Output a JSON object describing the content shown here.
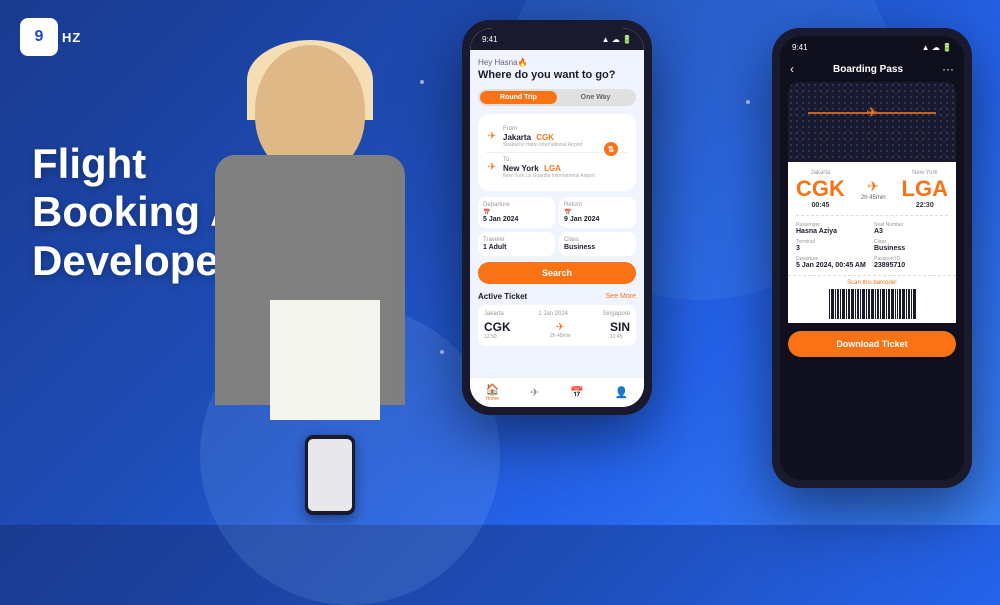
{
  "logo": {
    "icon": "9",
    "suffix": "HZ"
  },
  "headline": {
    "line1": "Flight",
    "line2": "Booking App",
    "line3": "Developers"
  },
  "phone1": {
    "status_time": "9:41",
    "greeting": "Hey Hasna🔥",
    "question": "Where do you want to go?",
    "trip_toggle": {
      "round_trip": "Round Trip",
      "one_way": "One Way"
    },
    "from_label": "From",
    "from_city": "Jakarta",
    "from_code": "CGK",
    "from_airport": "Soekarno Hatto International Airport",
    "to_label": "To",
    "to_city": "New York",
    "to_code": "LGA",
    "to_airport": "New York La Guardia International Airport",
    "departure_label": "Departure",
    "departure_date": "5 Jan 2024",
    "return_label": "Return",
    "return_date": "9 Jan 2024",
    "traveler_label": "Traveler",
    "traveler_value": "1 Adult",
    "class_label": "Class",
    "class_value": "Business",
    "search_btn": "Search",
    "active_ticket_label": "Active Ticket",
    "see_more": "See More",
    "ticket_from": "Jakarta",
    "ticket_date": "1 Jan 2024",
    "ticket_to": "Singapore",
    "ticket_from_code": "CGK",
    "ticket_to_code": "SIN",
    "ticket_from_time": "12:50",
    "ticket_duration": "2h 45min",
    "ticket_to_time": "12:45",
    "nav_home": "Home",
    "nav_flight": "✈",
    "nav_calendar": "📅",
    "nav_profile": "👤"
  },
  "phone2": {
    "status_time": "9:41",
    "title": "Boarding Pass",
    "from_city": "Jakarta",
    "from_code": "CGK",
    "from_time": "00:45",
    "duration": "2h 45min",
    "to_city": "New York",
    "to_code": "LGA",
    "to_time": "22:30",
    "passenger_label": "Passenger",
    "passenger_value": "Hasna Aziya",
    "seat_label": "Seat Number",
    "seat_value": "A3",
    "terminal_label": "Terminal",
    "terminal_value": "3",
    "class_label": "Class",
    "class_value": "Business",
    "departure_label": "Departure",
    "departure_value": "5 Jan 2024, 00:45 AM",
    "passport_label": "Passport ID",
    "passport_value": "23895710",
    "barcode_label": "Scan this barcode!",
    "download_btn": "Download Ticket"
  }
}
